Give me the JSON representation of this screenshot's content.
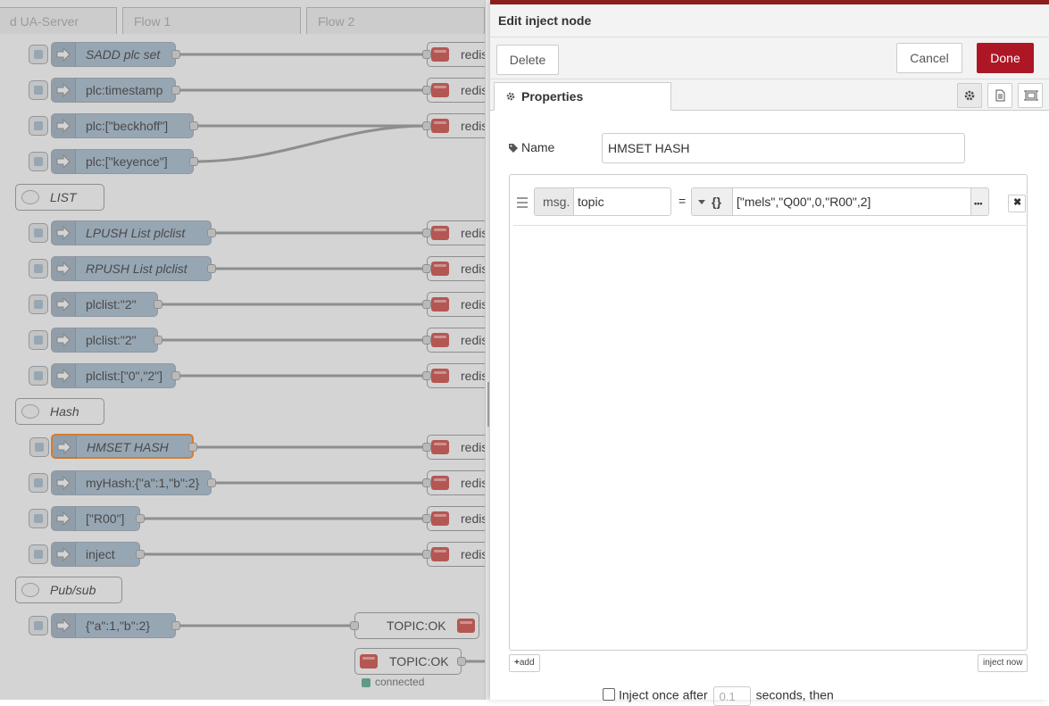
{
  "canvas": {
    "tabs": [
      "d UA-Server",
      "Flow 1",
      "Flow 2"
    ],
    "inject_nodes": [
      {
        "label": "SADD plc set",
        "italic": true
      },
      {
        "label": "plc:timestamp",
        "italic": false
      },
      {
        "label": "plc:[\"beckhoff\"]",
        "italic": false
      },
      {
        "label": "plc:[\"keyence\"]",
        "italic": false
      },
      {
        "label": "LPUSH List plclist",
        "italic": true
      },
      {
        "label": "RPUSH List plclist",
        "italic": true
      },
      {
        "label": "plclist:\"2\"",
        "italic": false
      },
      {
        "label": "plclist:\"2\"",
        "italic": false
      },
      {
        "label": "plclist:[\"0\",\"2\"]",
        "italic": false
      },
      {
        "label": "HMSET HASH",
        "italic": true,
        "selected": true
      },
      {
        "label": "myHash:{\"a\":1,\"b\":2}",
        "italic": false
      },
      {
        "label": "[\"R00\"]",
        "italic": false
      },
      {
        "label": "inject",
        "italic": false
      },
      {
        "label": "{\"a\":1,\"b\":2}",
        "italic": false
      }
    ],
    "comments": [
      "LIST",
      "Hash",
      "Pub/sub"
    ],
    "redis_label": "redis",
    "topic_out_label": "TOPIC:OK",
    "topic_in_label": "TOPIC:OK",
    "topic_in_status": "connected"
  },
  "tray": {
    "title": "Edit inject node",
    "delete_label": "Delete",
    "cancel_label": "Cancel",
    "done_label": "Done",
    "tab_properties": "Properties",
    "name_label": "Name",
    "name_value": "HMSET HASH",
    "row": {
      "prefix": "msg.",
      "property": "topic",
      "equals": "=",
      "type_icon": "{}",
      "value": "[\"mels\",\"Q00\",0,\"R00\",2]"
    },
    "add_label": "add",
    "inject_now_label": "inject now",
    "inject_once_label": "Inject once after",
    "inject_once_delay": "0.1",
    "inject_once_suffix": "seconds, then"
  },
  "colors": {
    "accent": "#ad1625",
    "inject_node": "#a6bbcf",
    "redis_red": "#d04841",
    "selected_outline": "#ff7f0e"
  }
}
